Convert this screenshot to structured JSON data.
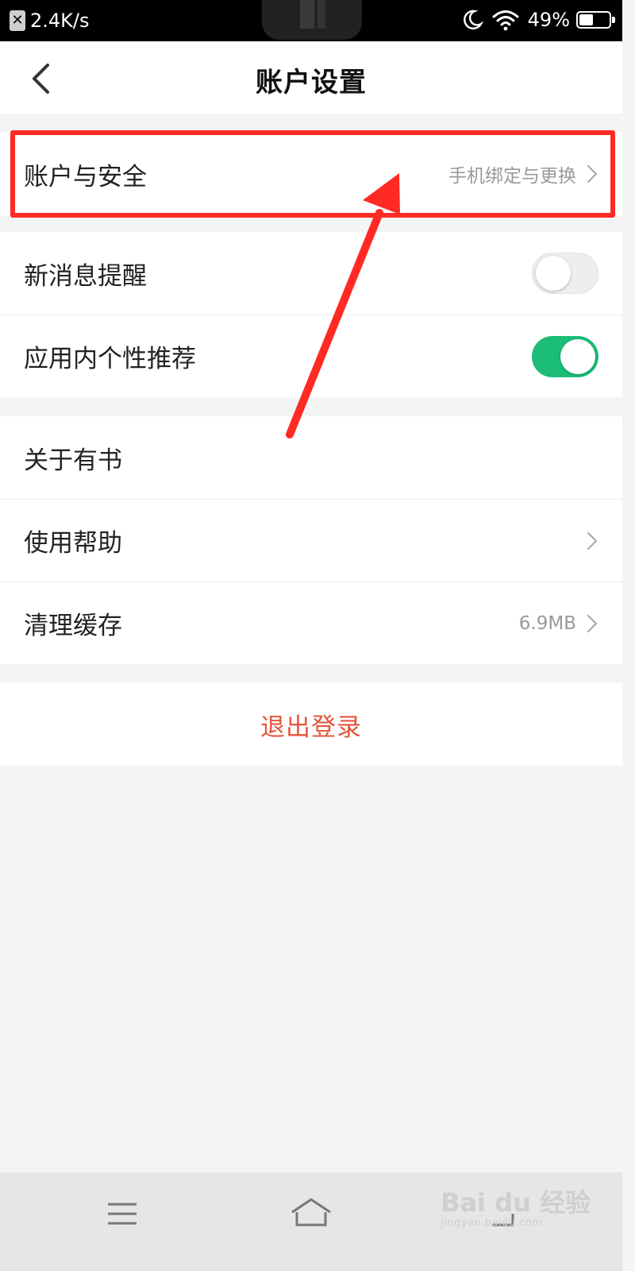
{
  "status_bar": {
    "close_glyph": "✕",
    "net_speed": "2.4K/s",
    "battery": "49%",
    "battery_level": 0.49,
    "icons": [
      "moon-icon",
      "wifi-icon",
      "battery-icon"
    ]
  },
  "header": {
    "title": "账户设置"
  },
  "groups": {
    "account": {
      "label": "账户与安全",
      "value": "手机绑定与更换"
    },
    "notifications": {
      "label": "新消息提醒",
      "toggle_on": false
    },
    "recommend": {
      "label": "应用内个性推荐",
      "toggle_on": true
    },
    "about": {
      "label": "关于有书"
    },
    "help": {
      "label": "使用帮助"
    },
    "cache": {
      "label": "清理缓存",
      "value": "6.9MB"
    }
  },
  "logout": {
    "label": "退出登录"
  },
  "watermark": {
    "main": "Bai du 经验",
    "sub": "jingyan.baidu.com"
  },
  "colors": {
    "toggle_on": "#1bbd79",
    "logout_text": "#e5553a",
    "annotation_red": "#ff2a24"
  }
}
